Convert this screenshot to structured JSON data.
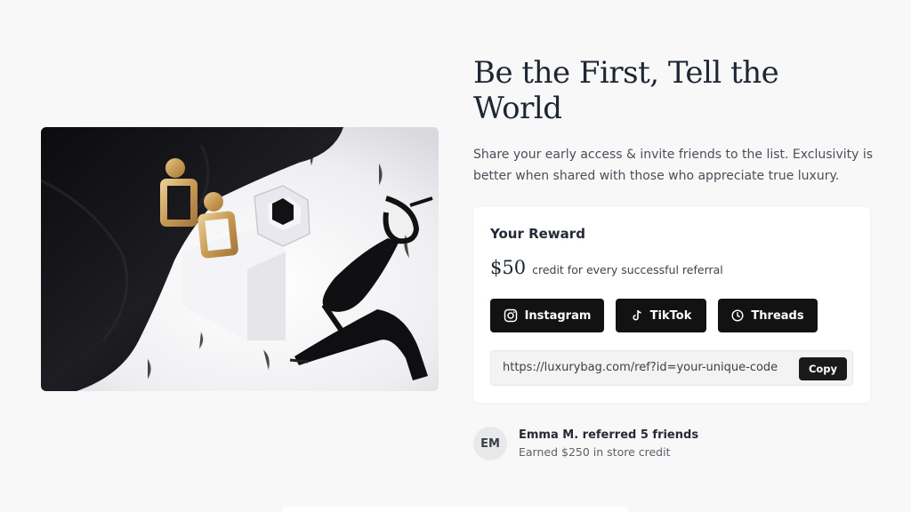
{
  "hero": {
    "headline": "Be the First, Tell the World",
    "subtext": "Share your early access & invite friends to the list. Exclusivity is better when shared with those who appreciate true luxury."
  },
  "reward": {
    "title": "Your Reward",
    "amount": "$50",
    "description": "credit for every successful referral",
    "social_buttons": [
      {
        "label": "Instagram",
        "icon": "instagram-icon"
      },
      {
        "label": "TikTok",
        "icon": "tiktok-icon"
      },
      {
        "label": "Threads",
        "icon": "threads-icon"
      }
    ],
    "referral_url": "https://luxurybag.com/ref?id=your-unique-code",
    "copy_label": "Copy"
  },
  "testimonial": {
    "initials": "EM",
    "name_line": "Emma M. referred 5 friends",
    "detail_line": "Earned $250 in store credit"
  },
  "colors": {
    "background": "#f8f8f8",
    "card": "#ffffff",
    "button_dark": "#121212",
    "text_dark": "#1e2633"
  }
}
